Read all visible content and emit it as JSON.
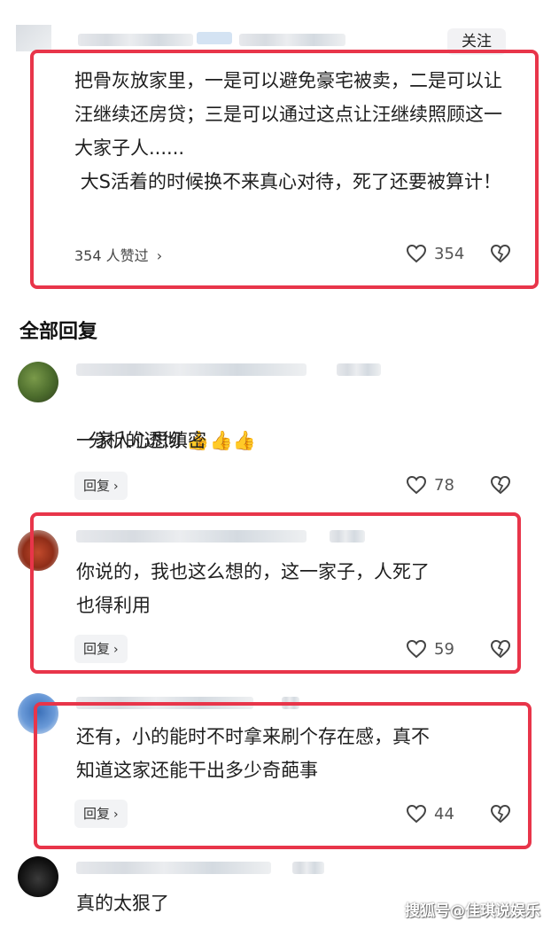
{
  "top_comment": {
    "follow_label": "关注",
    "text": "把骨灰放家里，一是可以避免豪宅被卖，二是可以让汪继续还房贷；三是可以通过这点让汪继续照顾这一大家子人......\n 大S活着的时候换不来真心对待，死了还要被算计！",
    "liked_by": "354 人赞过",
    "likes": "354"
  },
  "section_title": "全部回复",
  "replies": [
    {
      "line1": "分析的透彻",
      "line2": "一家人心思缜密",
      "emoji": "👍👍👍",
      "reply_label": "回复",
      "likes": "78"
    },
    {
      "line1": "你说的，我也这么想的，这一家子，人死了",
      "line2": "也得利用",
      "reply_label": "回复",
      "likes": "59"
    },
    {
      "line1": "还有，小的能时不时拿来刷个存在感，真不",
      "line2": "知道这家还能干出多少奇葩事",
      "reply_label": "回复",
      "likes": "44"
    },
    {
      "line1": "真的太狠了"
    }
  ],
  "watermark": "搜狐号@佳琪说娱乐",
  "colors": {
    "highlight": "#e8354a",
    "button_bg": "#f2f3f5",
    "text": "#1e1e1e"
  },
  "icons": [
    "heart-outline-icon",
    "dislike-heart-icon",
    "chevron-right-icon"
  ]
}
